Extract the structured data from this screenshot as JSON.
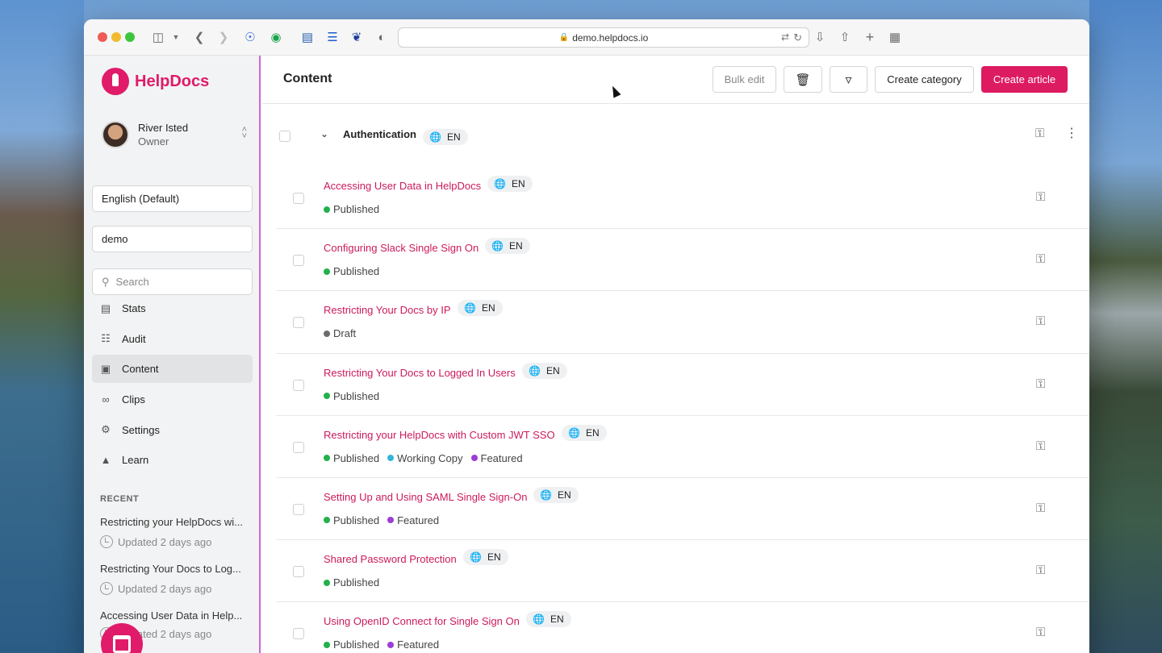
{
  "browser": {
    "url": "demo.helpdocs.io"
  },
  "app": {
    "name": "HelpDocs"
  },
  "user": {
    "name": "River Isted",
    "role": "Owner"
  },
  "sidebar": {
    "language": "English (Default)",
    "workspace": "demo",
    "search_placeholder": "Search",
    "nav": [
      {
        "label": "Stats",
        "icon": "bar-chart-icon"
      },
      {
        "label": "Audit",
        "icon": "clipboard-icon"
      },
      {
        "label": "Content",
        "icon": "archive-icon",
        "active": true
      },
      {
        "label": "Clips",
        "icon": "paperclip-icon"
      },
      {
        "label": "Settings",
        "icon": "sliders-icon"
      },
      {
        "label": "Learn",
        "icon": "graduation-cap-icon"
      }
    ],
    "recent_heading": "RECENT",
    "recent": [
      {
        "title": "Restricting your HelpDocs wi...",
        "time": "Updated 2 days ago"
      },
      {
        "title": "Restricting Your Docs to Log...",
        "time": "Updated 2 days ago"
      },
      {
        "title": "Accessing User Data in Help...",
        "time": "Updated 2 days ago"
      }
    ]
  },
  "main": {
    "title": "Content",
    "actions": {
      "bulk_edit": "Bulk edit",
      "create_category": "Create category",
      "create_article": "Create article"
    },
    "category": {
      "name": "Authentication",
      "lang": "EN"
    },
    "articles": [
      {
        "title": "Accessing User Data in HelpDocs",
        "lang": "EN",
        "statuses": [
          {
            "label": "Published",
            "kind": "published"
          }
        ]
      },
      {
        "title": "Configuring Slack Single Sign On",
        "lang": "EN",
        "statuses": [
          {
            "label": "Published",
            "kind": "published"
          }
        ]
      },
      {
        "title": "Restricting Your Docs by IP",
        "lang": "EN",
        "statuses": [
          {
            "label": "Draft",
            "kind": "draft"
          }
        ]
      },
      {
        "title": "Restricting Your Docs to Logged In Users",
        "lang": "EN",
        "statuses": [
          {
            "label": "Published",
            "kind": "published"
          }
        ]
      },
      {
        "title": "Restricting your HelpDocs with Custom JWT SSO",
        "lang": "EN",
        "statuses": [
          {
            "label": "Published",
            "kind": "published"
          },
          {
            "label": "Working Copy",
            "kind": "working"
          },
          {
            "label": "Featured",
            "kind": "featured"
          }
        ]
      },
      {
        "title": "Setting Up and Using SAML Single Sign-On",
        "lang": "EN",
        "statuses": [
          {
            "label": "Published",
            "kind": "published"
          },
          {
            "label": "Featured",
            "kind": "featured"
          }
        ]
      },
      {
        "title": "Shared Password Protection",
        "lang": "EN",
        "statuses": [
          {
            "label": "Published",
            "kind": "published"
          }
        ]
      },
      {
        "title": "Using OpenID Connect for Single Sign On",
        "lang": "EN",
        "statuses": [
          {
            "label": "Published",
            "kind": "published"
          },
          {
            "label": "Featured",
            "kind": "featured"
          }
        ]
      }
    ]
  },
  "colors": {
    "brand": "#e01b6a",
    "link": "#cc1a5c",
    "published": "#22b14c",
    "draft": "#6b6b6b",
    "working": "#35b5d8",
    "featured": "#9b3dd6"
  }
}
